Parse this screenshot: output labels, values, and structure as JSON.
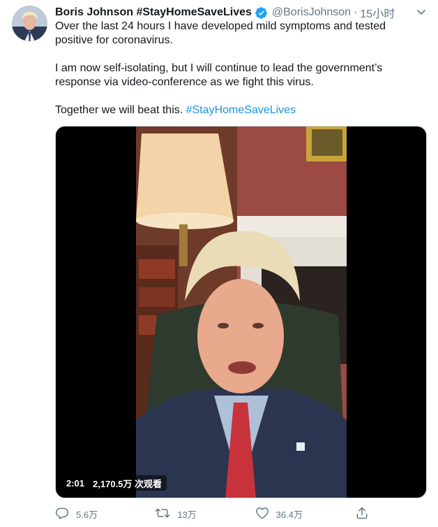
{
  "tweet": {
    "author": {
      "display_name": "Boris Johnson #StayHomeSaveLives",
      "handle": "@BorisJohnson",
      "separator": "·",
      "time": "15小时",
      "verified": true
    },
    "text": {
      "p1": "Over the last 24 hours I have developed mild symptoms and tested positive for coronavirus.",
      "p2": "I am now self-isolating, but I will continue to lead the government’s response via video-conference as we fight this virus.",
      "p3_text": "Together we will beat this. ",
      "p3_hashtag": "#StayHomeSaveLives"
    },
    "media": {
      "type": "video",
      "duration": "2:01",
      "views": "2,170.5万 次观看"
    },
    "actions": {
      "reply_count": "5.6万",
      "retweet_count": "13万",
      "like_count": "36.4万"
    }
  },
  "colors": {
    "text_primary": "#14171a",
    "text_secondary": "#657786",
    "link": "#1b95e0",
    "verified": "#1da1f2"
  },
  "icons": {
    "verified": "verified-badge-icon",
    "caret": "chevron-down-icon",
    "reply": "reply-icon",
    "retweet": "retweet-icon",
    "like": "heart-icon",
    "share": "share-icon"
  }
}
